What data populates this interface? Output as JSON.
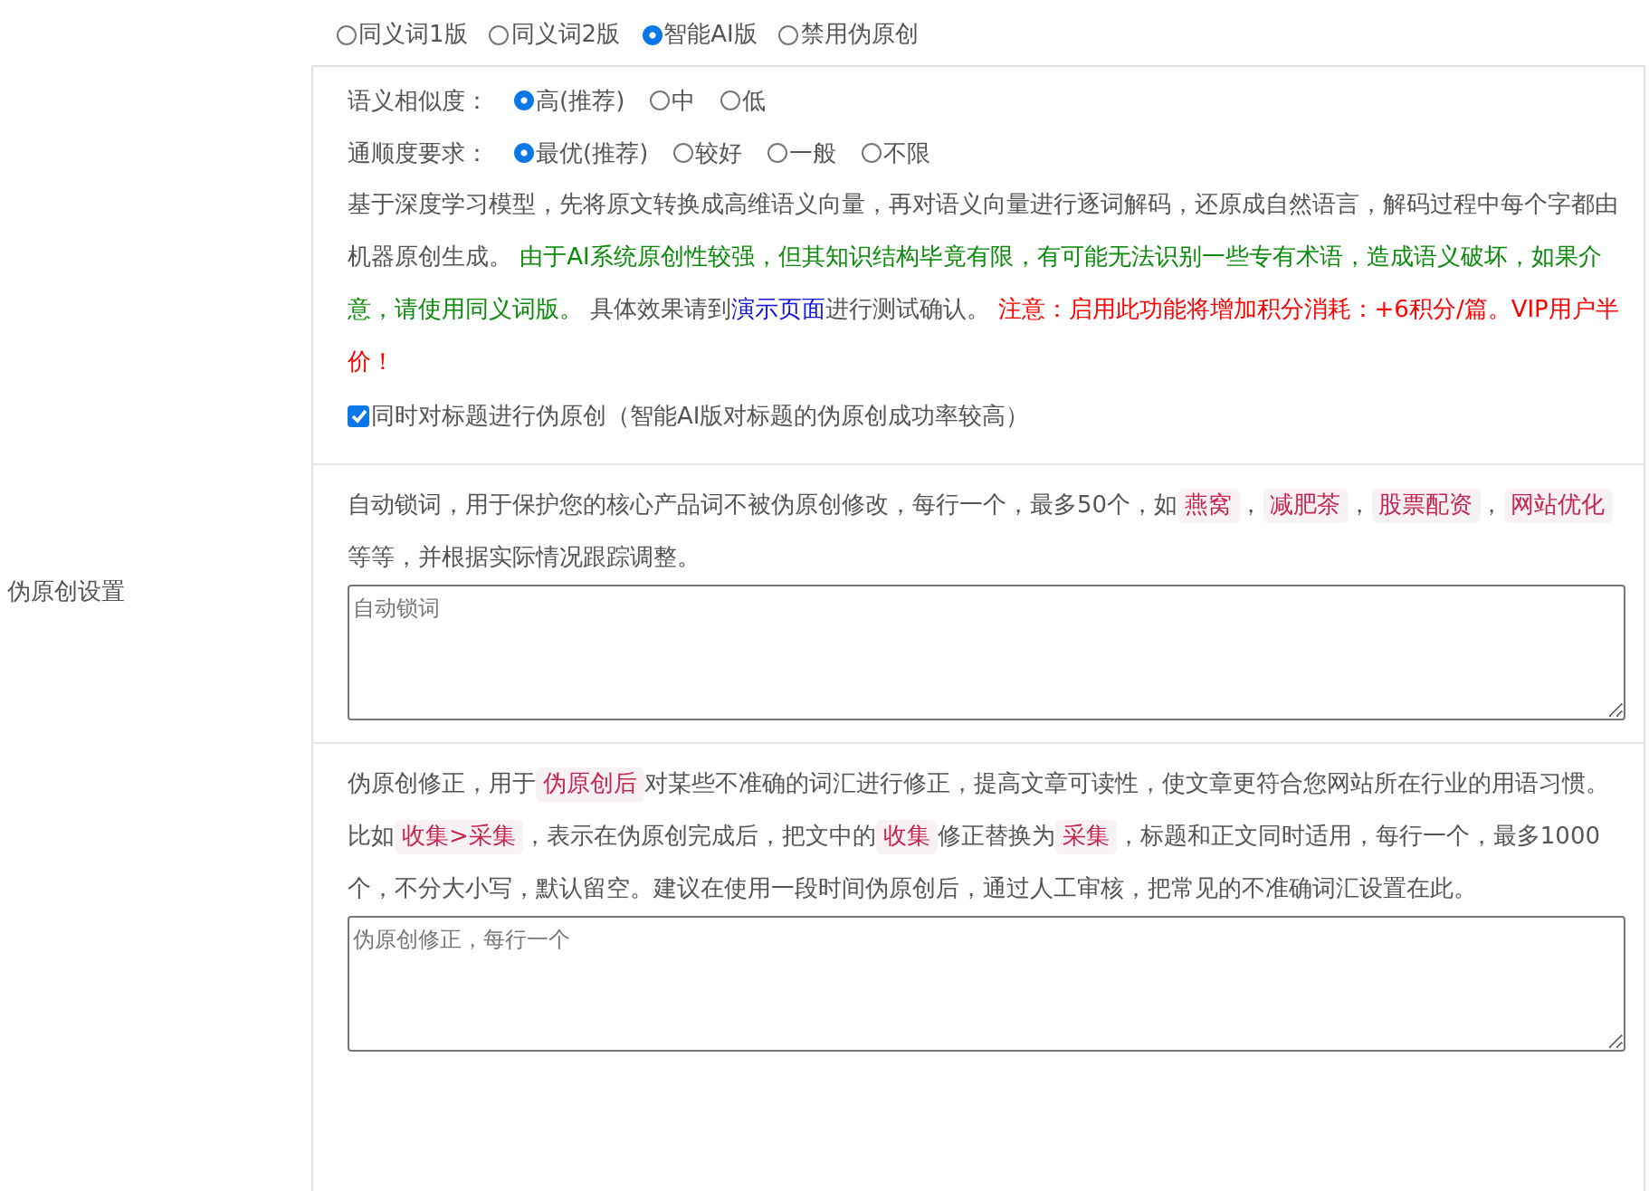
{
  "side_label": "伪原创设置",
  "modes": [
    {
      "label": "同义词1版",
      "selected": false
    },
    {
      "label": "同义词2版",
      "selected": false
    },
    {
      "label": "智能AI版",
      "selected": true
    },
    {
      "label": "禁用伪原创",
      "selected": false
    }
  ],
  "similarity": {
    "label": "语义相似度：",
    "options": [
      {
        "label": "高(推荐)",
        "selected": true
      },
      {
        "label": "中",
        "selected": false
      },
      {
        "label": "低",
        "selected": false
      }
    ]
  },
  "fluency": {
    "label": "通顺度要求：",
    "options": [
      {
        "label": "最优(推荐)",
        "selected": true
      },
      {
        "label": "较好",
        "selected": false
      },
      {
        "label": "一般",
        "selected": false
      },
      {
        "label": "不限",
        "selected": false
      }
    ]
  },
  "description": [
    {
      "kind": "plain",
      "text": "基于深度学习模型，先将原文转换成高维语义向量，再对语义向量进行逐词解码，还原成自然语言，解码过程中每个字都由机器原创生成。 "
    },
    {
      "kind": "green",
      "text": "由于AI系统原创性较强，但其知识结构毕竟有限，有可能无法识别一些专有术语，造成语义破坏，如果介意，请使用同义词版。"
    },
    {
      "kind": "plain",
      "text": " 具体效果请到"
    },
    {
      "kind": "link",
      "text": "演示页面"
    },
    {
      "kind": "plain",
      "text": "进行测试确认。 "
    },
    {
      "kind": "red",
      "text": "注意：启用此功能将增加积分消耗：+6积分/篇。VIP用户半价！"
    }
  ],
  "title_option": {
    "label": "同时对标题进行伪原创（智能AI版对标题的伪原创成功率较高）",
    "checked": true
  },
  "lock_words": {
    "help": [
      {
        "kind": "plain",
        "text": "自动锁词，用于保护您的核心产品词不被伪原创修改，每行一个，最多50个，如"
      },
      {
        "kind": "tag",
        "text": "燕窝"
      },
      {
        "kind": "plain",
        "text": "，"
      },
      {
        "kind": "tag",
        "text": "减肥茶"
      },
      {
        "kind": "plain",
        "text": "，"
      },
      {
        "kind": "tag",
        "text": "股票配资"
      },
      {
        "kind": "plain",
        "text": "，"
      },
      {
        "kind": "tag",
        "text": "网站优化"
      },
      {
        "kind": "plain",
        "text": "等等，并根据实际情况跟踪调整。"
      }
    ],
    "placeholder": "自动锁词"
  },
  "corrections": {
    "help": [
      {
        "kind": "plain",
        "text": "伪原创修正，用于"
      },
      {
        "kind": "tag",
        "text": "伪原创后"
      },
      {
        "kind": "plain",
        "text": "对某些不准确的词汇进行修正，提高文章可读性，使文章更符合您网站所在行业的用语习惯。比如"
      },
      {
        "kind": "tag",
        "text": "收集>采集"
      },
      {
        "kind": "plain",
        "text": "，表示在伪原创完成后，把文中的"
      },
      {
        "kind": "tag",
        "text": "收集"
      },
      {
        "kind": "plain",
        "text": "修正替换为"
      },
      {
        "kind": "tag",
        "text": "采集"
      },
      {
        "kind": "plain",
        "text": "，标题和正文同时适用，每行一个，最多1000个，不分大小写，默认留空。建议在使用一段时间伪原创后，通过人工审核，把常见的不准确词汇设置在此。"
      }
    ],
    "placeholder": "伪原创修正，每行一个"
  }
}
